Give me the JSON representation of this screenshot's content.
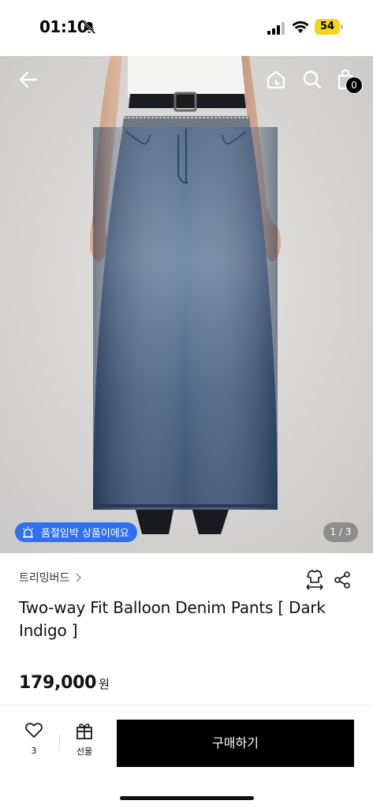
{
  "status_bar": {
    "time": "01:10",
    "battery_level": "54",
    "battery_color": "#f5d515",
    "icons": [
      "bell-off-icon",
      "signal-icon",
      "wifi-icon",
      "battery-icon"
    ]
  },
  "hero": {
    "nav_icons": [
      "back-arrow-icon",
      "home-icon",
      "search-icon",
      "shopping-bag-icon"
    ],
    "cart_count": "0",
    "soldout_badge": "품절임박 상품이에요",
    "soldout_badge_color": "#2f6ff2",
    "page_indicator": "1 / 3"
  },
  "product": {
    "brand": "트리밍버드",
    "title": "Two-way Fit Balloon Denim Pants [ Dark Indigo ]",
    "price": "179,000",
    "currency": "원",
    "icons": [
      "size-guide-icon",
      "share-icon"
    ]
  },
  "bottom_bar": {
    "like_count": "3",
    "gift_label": "선물",
    "buy_label": "구매하기",
    "buy_color": "#000000"
  }
}
